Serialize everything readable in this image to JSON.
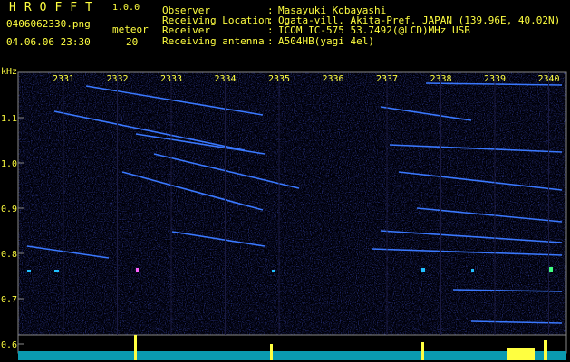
{
  "app": {
    "title": "HROFFT",
    "version": "1.0.0"
  },
  "file": {
    "name": "0406062330.png",
    "datetime": "04.06.06 23:30"
  },
  "meteor": {
    "label": "meteor",
    "count": "20"
  },
  "info": [
    {
      "key": "Observer",
      "value": "Masayuki Kobayashi"
    },
    {
      "key": "Receiving Location",
      "value": "Ogata-vill. Akita-Pref. JAPAN (139.96E, 40.02N)"
    },
    {
      "key": "Receiver",
      "value": "ICOM IC-575 53.7492(@LCD)MHz USB"
    },
    {
      "key": "Receiving antenna",
      "value": "A504HB(yagi 4el)"
    }
  ],
  "axis": {
    "unit": "kHz",
    "y_ticks": [
      "1.1",
      "1.0",
      "0.9",
      "0.8",
      "0.7",
      "0.6"
    ],
    "x_ticks": [
      "2331",
      "2332",
      "2333",
      "2334",
      "2335",
      "2336",
      "2337",
      "2338",
      "2339",
      "2340"
    ]
  },
  "colors": {
    "background": "#000000",
    "text": "#ffff40",
    "noise": "#101070",
    "trace": "#4080ff",
    "baseline": "#20c0ff"
  }
}
